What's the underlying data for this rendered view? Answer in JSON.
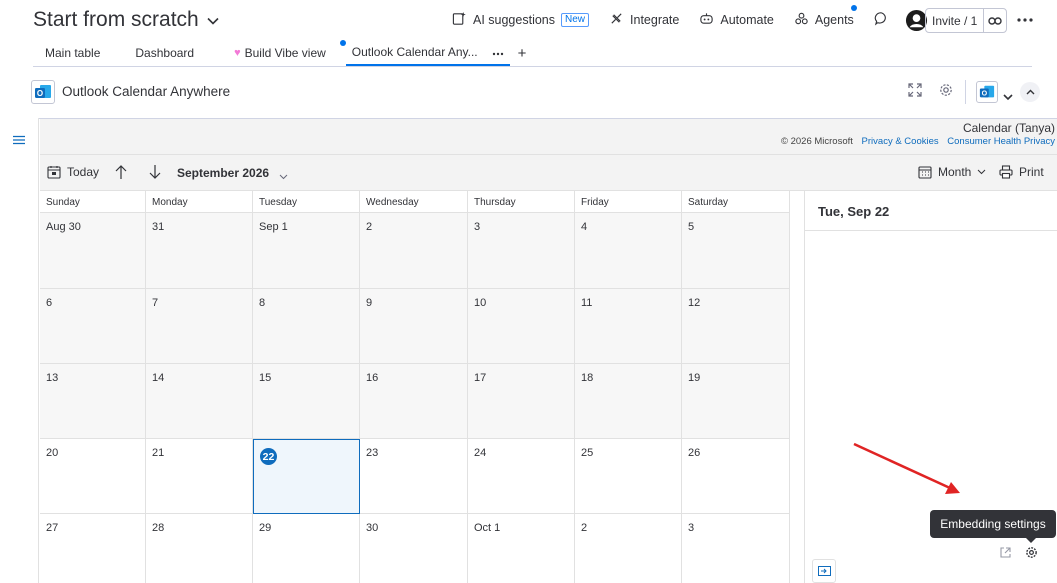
{
  "board": {
    "title": "Start from scratch"
  },
  "header": {
    "ai_suggestions": "AI suggestions",
    "new_badge": "New",
    "integrate": "Integrate",
    "automate": "Automate",
    "agents": "Agents",
    "invite": "Invite / 1"
  },
  "tabs": [
    {
      "label": "Main table"
    },
    {
      "label": "Dashboard"
    },
    {
      "label": "Build Vibe view"
    },
    {
      "label": "Outlook Calendar Any..."
    }
  ],
  "widget": {
    "title": "Outlook Calendar Anywhere"
  },
  "outlook": {
    "calendar_owner": "Calendar (Tanya)",
    "copyright": "© 2026 Microsoft",
    "privacy": "Privacy & Cookies",
    "health_privacy": "Consumer Health Privacy",
    "today": "Today",
    "month_label": "September 2026",
    "view": "Month",
    "print": "Print",
    "day_headers": [
      "Sunday",
      "Monday",
      "Tuesday",
      "Wednesday",
      "Thursday",
      "Friday",
      "Saturday"
    ],
    "weeks": [
      [
        "Aug 30",
        "31",
        "Sep 1",
        "2",
        "3",
        "4",
        "5"
      ],
      [
        "6",
        "7",
        "8",
        "9",
        "10",
        "11",
        "12"
      ],
      [
        "13",
        "14",
        "15",
        "16",
        "17",
        "18",
        "19"
      ],
      [
        "20",
        "21",
        "22",
        "23",
        "24",
        "25",
        "26"
      ],
      [
        "27",
        "28",
        "29",
        "30",
        "Oct 1",
        "2",
        "3"
      ]
    ],
    "today_date": "22",
    "selected_day": "Tue, Sep 22"
  },
  "tooltip": {
    "text": "Embedding settings"
  },
  "colors": {
    "accent": "#0073ea",
    "outlook_blue": "#0f6cbd",
    "arrow": "#e02424"
  }
}
